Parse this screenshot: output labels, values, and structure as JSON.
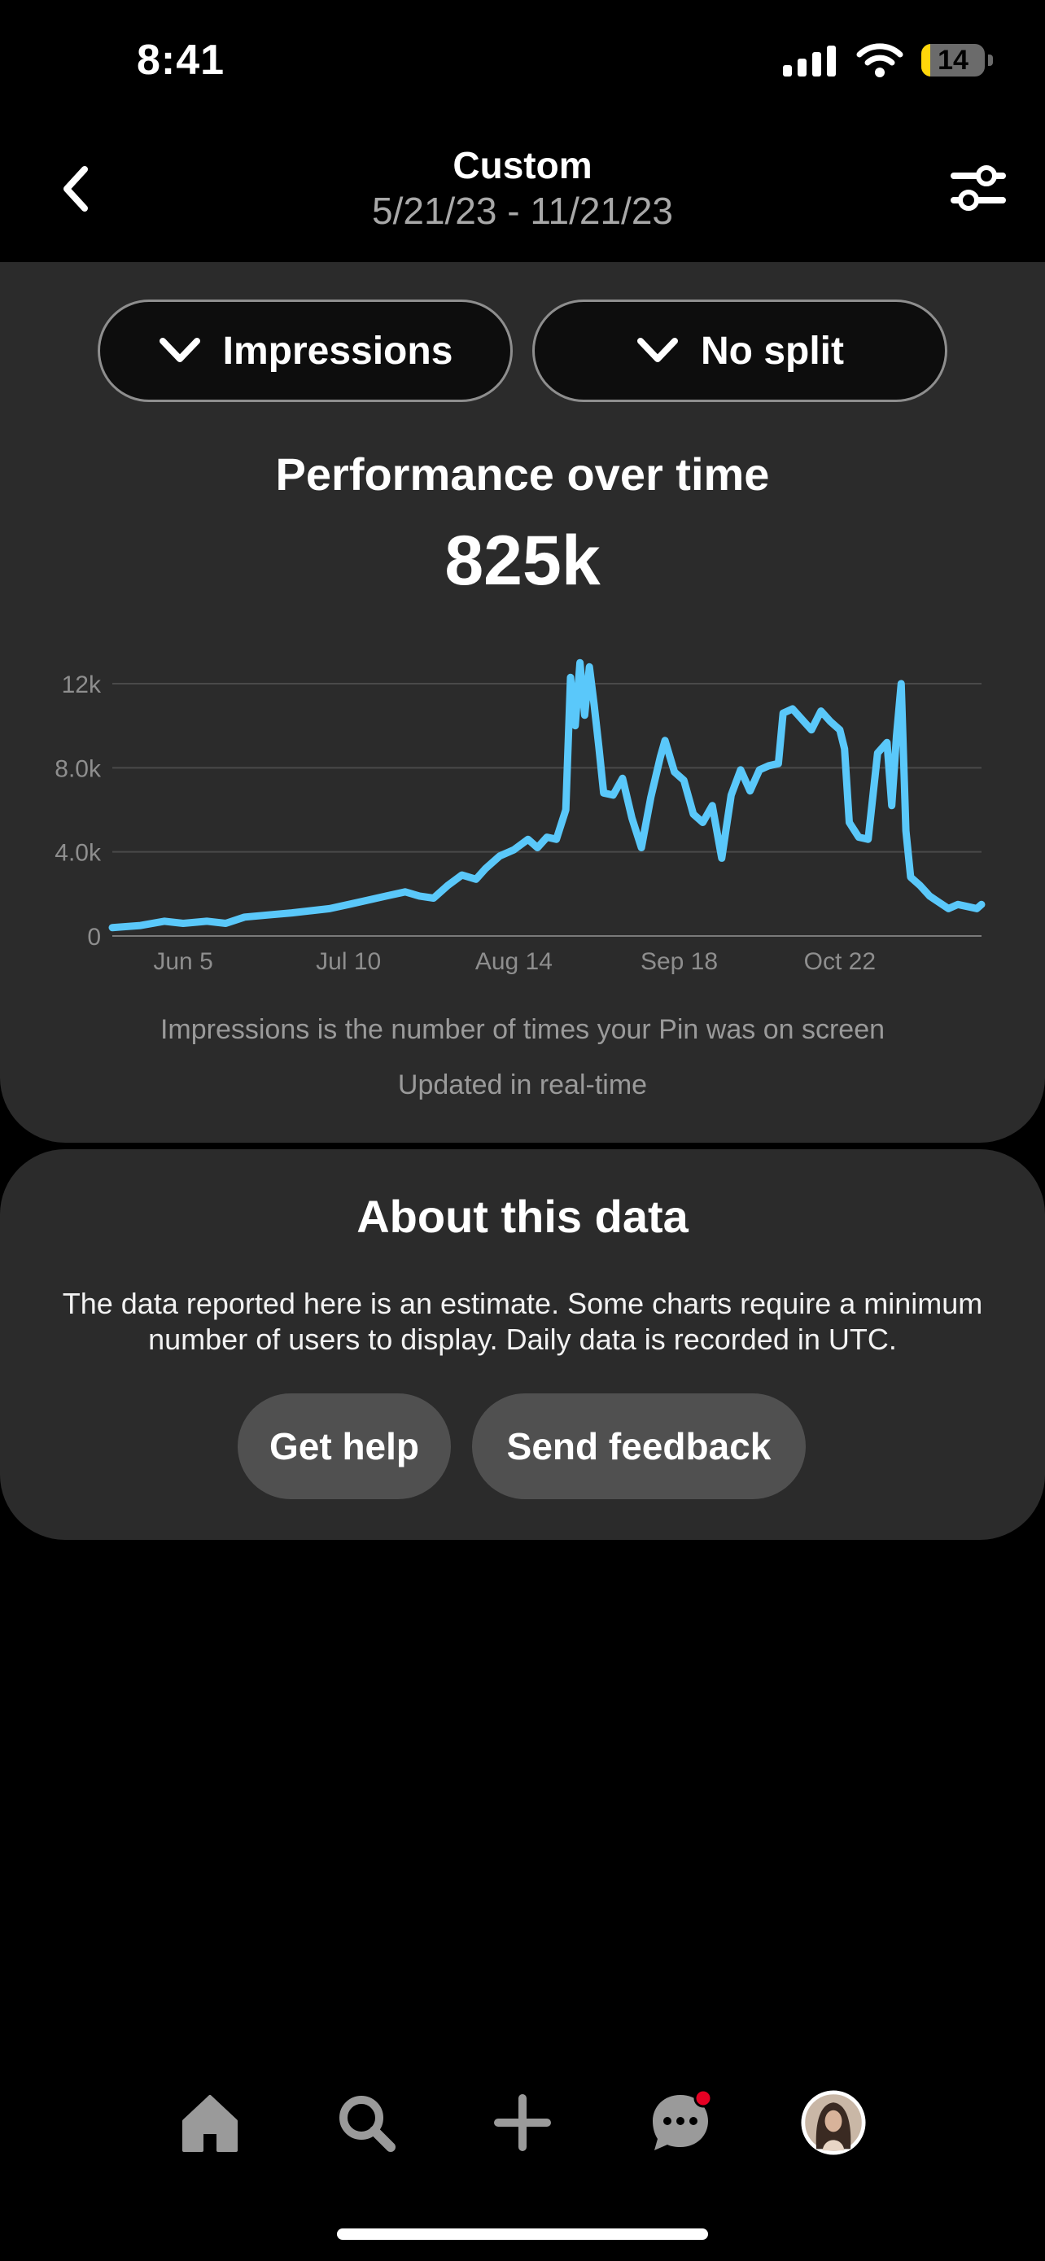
{
  "status_bar": {
    "time": "8:41",
    "battery": "14",
    "battery_level": 0.14
  },
  "header": {
    "title": "Custom",
    "date_range": "5/21/23 - 11/21/23"
  },
  "filters": {
    "metric": "Impressions",
    "split": "No split"
  },
  "performance": {
    "title": "Performance over time",
    "total": "825k"
  },
  "chart_data": {
    "type": "line",
    "title": "",
    "xlabel": "",
    "ylabel": "",
    "x_ticks": [
      "Jun 5",
      "Jul 10",
      "Aug 14",
      "Sep 18",
      "Oct 22"
    ],
    "y_ticks": [
      "0",
      "4.0k",
      "8.0k",
      "12k"
    ],
    "ylim": [
      0,
      12000
    ],
    "grid": true,
    "color": "#5ac8fa",
    "series": [
      {
        "name": "",
        "points": [
          [
            "2023-05-21",
            400
          ],
          [
            "2023-05-27",
            500
          ],
          [
            "2023-06-01",
            700
          ],
          [
            "2023-06-05",
            600
          ],
          [
            "2023-06-10",
            700
          ],
          [
            "2023-06-14",
            600
          ],
          [
            "2023-06-18",
            900
          ],
          [
            "2023-06-23",
            1000
          ],
          [
            "2023-06-28",
            1100
          ],
          [
            "2023-07-02",
            1200
          ],
          [
            "2023-07-06",
            1300
          ],
          [
            "2023-07-10",
            1500
          ],
          [
            "2023-07-14",
            1700
          ],
          [
            "2023-07-18",
            1900
          ],
          [
            "2023-07-22",
            2100
          ],
          [
            "2023-07-25",
            1900
          ],
          [
            "2023-07-28",
            1800
          ],
          [
            "2023-07-31",
            2400
          ],
          [
            "2023-08-03",
            2900
          ],
          [
            "2023-08-06",
            2700
          ],
          [
            "2023-08-08",
            3200
          ],
          [
            "2023-08-11",
            3800
          ],
          [
            "2023-08-14",
            4100
          ],
          [
            "2023-08-17",
            4600
          ],
          [
            "2023-08-19",
            4200
          ],
          [
            "2023-08-21",
            4700
          ],
          [
            "2023-08-23",
            4600
          ],
          [
            "2023-08-25",
            6000
          ],
          [
            "2023-08-26",
            12300
          ],
          [
            "2023-08-27",
            10000
          ],
          [
            "2023-08-28",
            13000
          ],
          [
            "2023-08-29",
            10500
          ],
          [
            "2023-08-30",
            12800
          ],
          [
            "2023-08-31",
            11000
          ],
          [
            "2023-09-01",
            9000
          ],
          [
            "2023-09-02",
            6800
          ],
          [
            "2023-09-04",
            6700
          ],
          [
            "2023-09-06",
            7500
          ],
          [
            "2023-09-08",
            5600
          ],
          [
            "2023-09-10",
            4200
          ],
          [
            "2023-09-12",
            6600
          ],
          [
            "2023-09-14",
            8500
          ],
          [
            "2023-09-15",
            9300
          ],
          [
            "2023-09-17",
            7800
          ],
          [
            "2023-09-19",
            7400
          ],
          [
            "2023-09-21",
            5800
          ],
          [
            "2023-09-23",
            5400
          ],
          [
            "2023-09-25",
            6200
          ],
          [
            "2023-09-27",
            3700
          ],
          [
            "2023-09-29",
            6700
          ],
          [
            "2023-10-01",
            7900
          ],
          [
            "2023-10-03",
            6900
          ],
          [
            "2023-10-05",
            7900
          ],
          [
            "2023-10-07",
            8100
          ],
          [
            "2023-10-09",
            8200
          ],
          [
            "2023-10-10",
            10600
          ],
          [
            "2023-10-12",
            10800
          ],
          [
            "2023-10-14",
            10300
          ],
          [
            "2023-10-16",
            9800
          ],
          [
            "2023-10-18",
            10700
          ],
          [
            "2023-10-20",
            10200
          ],
          [
            "2023-10-22",
            9800
          ],
          [
            "2023-10-23",
            8900
          ],
          [
            "2023-10-24",
            5400
          ],
          [
            "2023-10-26",
            4700
          ],
          [
            "2023-10-28",
            4600
          ],
          [
            "2023-10-30",
            8700
          ],
          [
            "2023-11-01",
            9200
          ],
          [
            "2023-11-02",
            6200
          ],
          [
            "2023-11-03",
            9500
          ],
          [
            "2023-11-04",
            12000
          ],
          [
            "2023-11-05",
            5000
          ],
          [
            "2023-11-06",
            2800
          ],
          [
            "2023-11-08",
            2400
          ],
          [
            "2023-11-10",
            1900
          ],
          [
            "2023-11-12",
            1600
          ],
          [
            "2023-11-14",
            1300
          ],
          [
            "2023-11-16",
            1500
          ],
          [
            "2023-11-18",
            1400
          ],
          [
            "2023-11-20",
            1300
          ],
          [
            "2023-11-21",
            1500
          ]
        ]
      }
    ]
  },
  "footnotes": {
    "definition": "Impressions is the number of times your Pin was on screen",
    "updated": "Updated in real-time"
  },
  "about": {
    "title": "About this data",
    "text": "The data reported here is an estimate. Some charts require a minimum number of users to display. Daily data is recorded in UTC.",
    "help_button": "Get help",
    "feedback_button": "Send feedback"
  },
  "tab_bar": {
    "icons": [
      "home-icon",
      "search-icon",
      "create-icon",
      "messages-icon",
      "profile-avatar"
    ],
    "notification_color": "#e60023"
  }
}
